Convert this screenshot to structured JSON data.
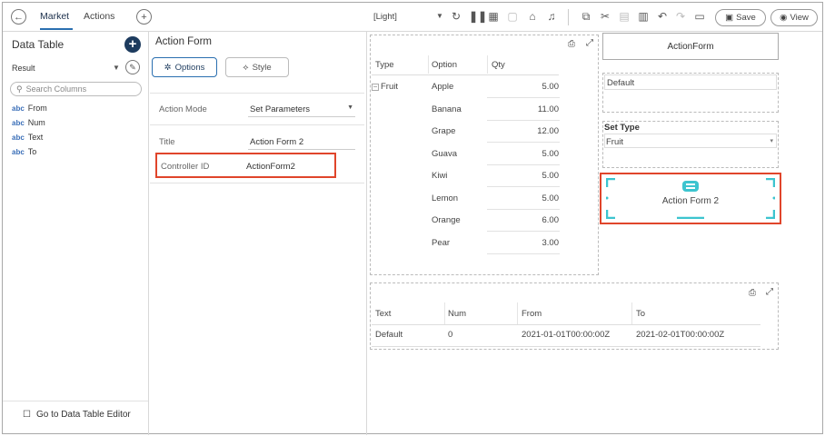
{
  "topbar": {
    "tabs": [
      "Market",
      "Actions"
    ],
    "theme": "[Light]",
    "save_label": "Save",
    "view_label": "View"
  },
  "left": {
    "title": "Data Table",
    "source": "Result",
    "search_placeholder": "Search Columns",
    "columns": [
      {
        "type": "abc",
        "name": "From"
      },
      {
        "type": "abc",
        "name": "Num"
      },
      {
        "type": "abc",
        "name": "Text"
      },
      {
        "type": "abc",
        "name": "To"
      }
    ],
    "footer_link": "Go to Data Table Editor"
  },
  "middle": {
    "title": "Action Form",
    "tab_options": "Options",
    "tab_style": "Style",
    "action_mode_label": "Action Mode",
    "action_mode_value": "Set Parameters",
    "title_label": "Title",
    "title_value": "Action Form 2",
    "controller_label": "Controller ID",
    "controller_value": "ActionForm2"
  },
  "dashboard": {
    "table1": {
      "headers": [
        "Type",
        "Option",
        "Qty"
      ],
      "group": "Fruit",
      "rows": [
        {
          "option": "Apple",
          "qty": "5.00"
        },
        {
          "option": "Banana",
          "qty": "11.00"
        },
        {
          "option": "Grape",
          "qty": "12.00"
        },
        {
          "option": "Guava",
          "qty": "5.00"
        },
        {
          "option": "Kiwi",
          "qty": "5.00"
        },
        {
          "option": "Lemon",
          "qty": "5.00"
        },
        {
          "option": "Orange",
          "qty": "6.00"
        },
        {
          "option": "Pear",
          "qty": "3.00"
        }
      ]
    },
    "action_form_title": "ActionForm",
    "default_text": "Default",
    "set_type_label": "Set Type",
    "set_type_value": "Fruit",
    "action_form2_label": "Action Form 2",
    "table2": {
      "headers": [
        "Text",
        "Num",
        "From",
        "To"
      ],
      "row": [
        "Default",
        "0",
        "2021-01-01T00:00:00Z",
        "2021-02-01T00:00:00Z"
      ]
    }
  },
  "colors": {
    "accent": "#2a6fb0",
    "highlight": "#e0452b",
    "teal": "#3cc4cf"
  }
}
